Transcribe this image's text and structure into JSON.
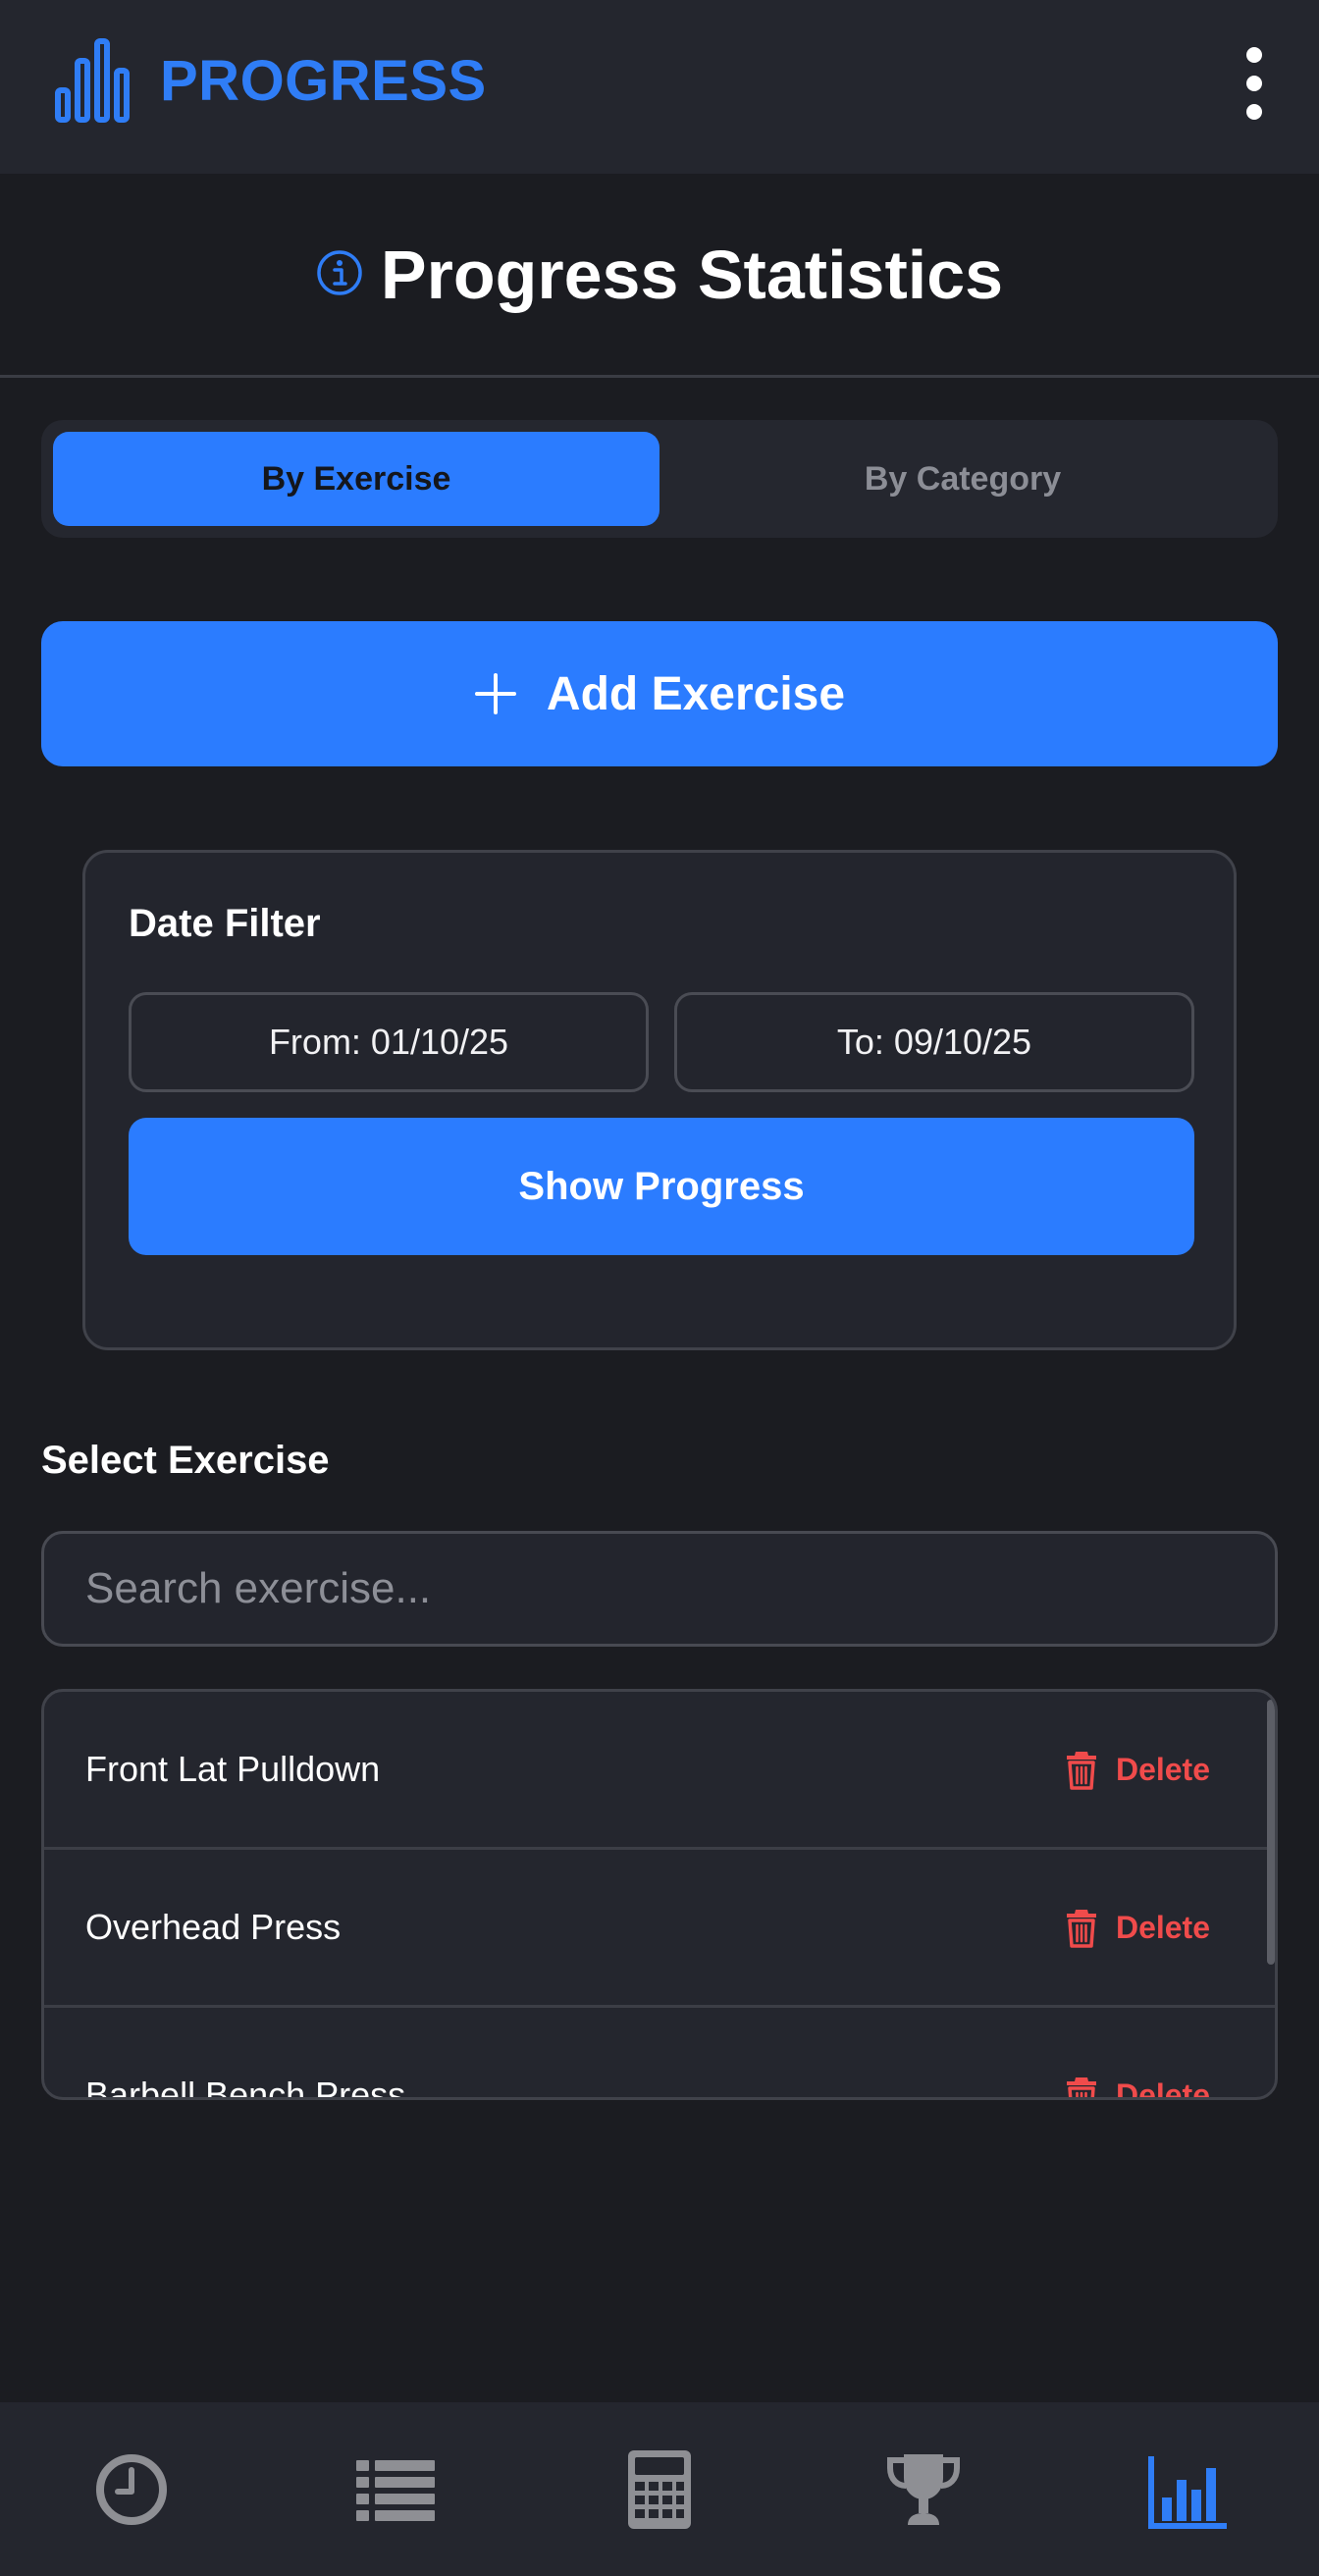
{
  "header": {
    "app_title": "PROGRESS",
    "brand_icon": "bar-chart-icon",
    "menu_icon": "more-vertical-icon"
  },
  "page": {
    "title": "Progress Statistics",
    "title_icon": "info-icon"
  },
  "tabs": [
    {
      "label": "By Exercise",
      "active": true
    },
    {
      "label": "By Category",
      "active": false
    }
  ],
  "add_button": {
    "label": "Add Exercise",
    "icon": "plus-icon"
  },
  "date_filter": {
    "title": "Date Filter",
    "from_label": "From: 01/10/25",
    "to_label": "To: 09/10/25",
    "show_button": "Show Progress"
  },
  "select_exercise": {
    "label": "Select Exercise",
    "search_placeholder": "Search exercise...",
    "search_value": ""
  },
  "exercises": [
    {
      "name": "Front Lat Pulldown",
      "action": "Delete"
    },
    {
      "name": "Overhead Press",
      "action": "Delete"
    },
    {
      "name": "Barbell Bench Press",
      "action": "Delete"
    }
  ],
  "bottom_nav": [
    {
      "icon": "clock-icon",
      "active": false
    },
    {
      "icon": "list-icon",
      "active": false
    },
    {
      "icon": "calculator-icon",
      "active": false
    },
    {
      "icon": "trophy-icon",
      "active": false
    },
    {
      "icon": "bar-chart-icon",
      "active": true
    }
  ],
  "colors": {
    "accent": "#2b7cff",
    "background": "#1b1c21",
    "surface": "#24262e",
    "danger": "#f04b4b",
    "inactive_icon": "#8e8f94"
  }
}
